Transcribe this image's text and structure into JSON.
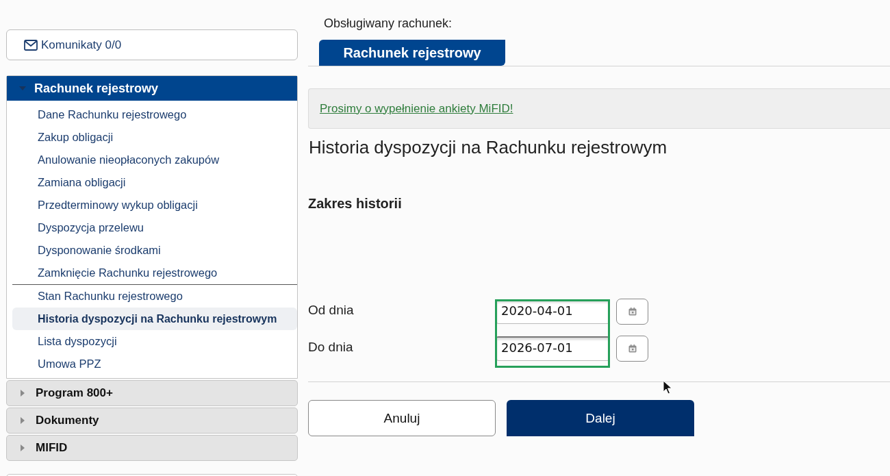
{
  "sidebar": {
    "messages": {
      "label": "Komunikaty 0/0"
    },
    "menu": [
      {
        "label": "Rachunek rejestrowy",
        "expanded": true,
        "sections": [
          {
            "items": [
              {
                "label": "Dane Rachunku rejestrowego",
                "selected": false
              },
              {
                "label": "Zakup obligacji",
                "selected": false
              },
              {
                "label": "Anulowanie nieopłaconych zakupów",
                "selected": false
              },
              {
                "label": "Zamiana obligacji",
                "selected": false
              },
              {
                "label": "Przedterminowy wykup obligacji",
                "selected": false
              },
              {
                "label": "Dyspozycja przelewu",
                "selected": false
              },
              {
                "label": "Dysponowanie środkami",
                "selected": false
              },
              {
                "label": "Zamknięcie Rachunku rejestrowego",
                "selected": false
              }
            ]
          },
          {
            "items": [
              {
                "label": "Stan Rachunku rejestrowego",
                "selected": false
              },
              {
                "label": "Historia dyspozycji na Rachunku rejestrowym",
                "selected": true
              },
              {
                "label": "Lista dyspozycji",
                "selected": false
              },
              {
                "label": "Umowa PPZ",
                "selected": false
              }
            ]
          }
        ]
      },
      {
        "label": "Program 800+",
        "expanded": false
      },
      {
        "label": "Dokumenty",
        "expanded": false
      },
      {
        "label": "MIFID",
        "expanded": false
      }
    ]
  },
  "main": {
    "account_label": "Obsługiwany rachunek:",
    "tabs": [
      {
        "label": "Rachunek rejestrowy",
        "selected": true
      }
    ],
    "notice": {
      "link": "Prosimy o wypełnienie ankiety MiFID!"
    },
    "title": "Historia dyspozycji na Rachunku rejestrowym",
    "section_title": "Zakres historii",
    "fields_highlighted": true,
    "fields": [
      {
        "label": "Od dnia",
        "value": "2020-04-01"
      },
      {
        "label": "Do dnia",
        "value": "2026-07-01"
      }
    ],
    "buttons": [
      {
        "label": "Anuluj",
        "kind": "secondary"
      },
      {
        "label": "Dalej",
        "kind": "primary"
      }
    ]
  }
}
